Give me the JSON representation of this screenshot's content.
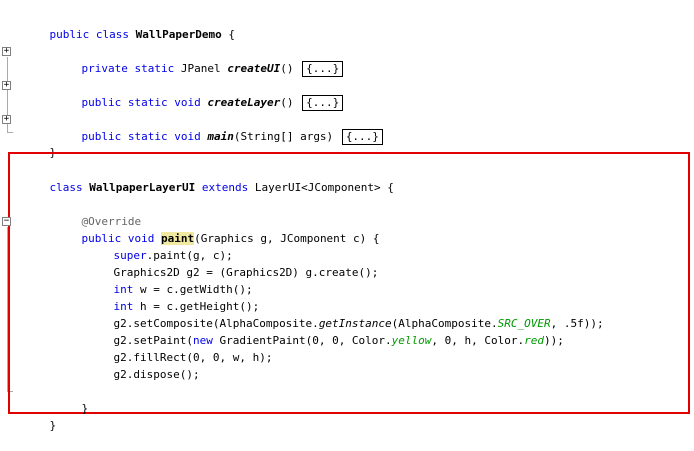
{
  "editor": {
    "class1": {
      "kw_public": "public",
      "kw_class": "class",
      "name": "WallPaperDemo",
      "brace": "{",
      "close": "}"
    },
    "method_createUI": {
      "mods": "private static",
      "type": "JPanel",
      "name": "createUI",
      "params": "()",
      "folded": "{...}"
    },
    "method_createLayer": {
      "mods": "public static void",
      "name": "createLayer",
      "params": "()",
      "folded": "{...}"
    },
    "method_main": {
      "mods": "public static void",
      "name": "main",
      "params": "(String[] args)",
      "folded": "{...}"
    },
    "class2": {
      "kw_class": "class",
      "name": "WallpaperLayerUI",
      "kw_extends": "extends",
      "super": "LayerUI<JComponent> {",
      "close": "}"
    },
    "paint": {
      "annotation": "@Override",
      "mods": "public void",
      "name": "paint",
      "params": "(Graphics g, JComponent c) {",
      "close": "}"
    },
    "body": {
      "l1_kw": "super",
      "l1_rest": ".paint(g, c);",
      "l2": "Graphics2D g2 = (Graphics2D) g.create();",
      "l3_kw": "int",
      "l3_rest": " w = c.getWidth();",
      "l4_kw": "int",
      "l4_rest": " h = c.getHeight();",
      "l5_a": "g2.setComposite(AlphaComposite.",
      "l5_method": "getInstance",
      "l5_b": "(AlphaComposite.",
      "l5_const": "SRC_OVER",
      "l5_c": ", .5f));",
      "l6_a": "g2.setPaint(",
      "l6_kw": "new",
      "l6_b": " GradientPaint(0, 0, Color.",
      "l6_c1": "yellow",
      "l6_c": ", 0, h, Color.",
      "l6_c2": "red",
      "l6_d": "));",
      "l7": "g2.fillRect(0, 0, w, h);",
      "l8": "g2.dispose();"
    }
  },
  "colors": {
    "keyword": "#0000e6",
    "constant": "#009900",
    "highlight_border": "#e00000",
    "match_highlight": "#f2e9a0"
  }
}
